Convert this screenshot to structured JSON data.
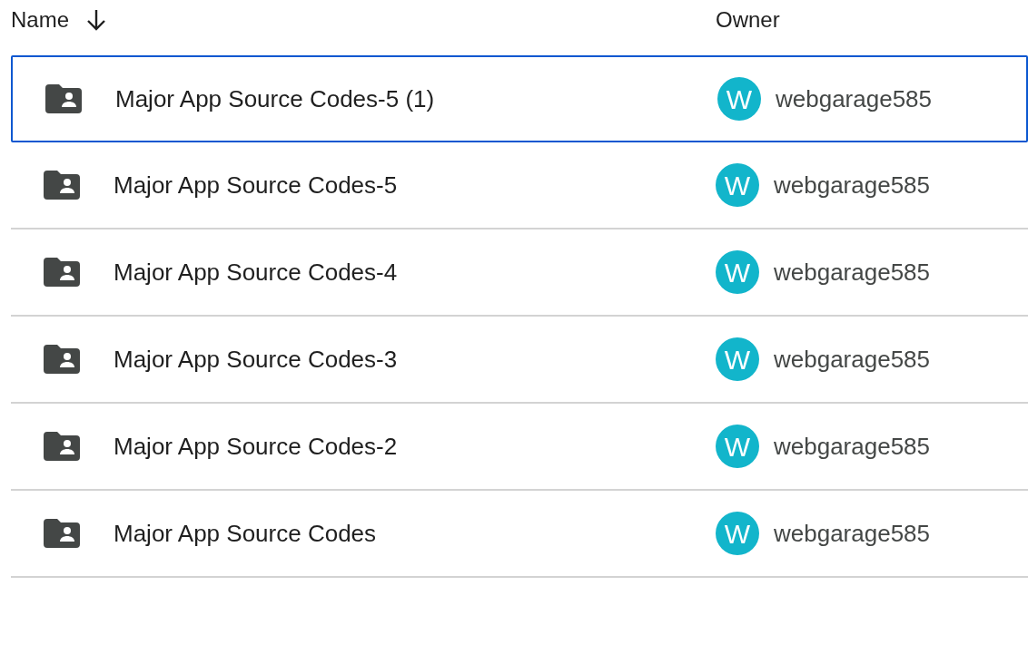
{
  "columns": [
    {
      "label": "Name",
      "sorted": true
    },
    {
      "label": "Owner",
      "sorted": false
    }
  ],
  "rows": [
    {
      "name": "Major App Source Codes-5 (1)",
      "avatar": "W",
      "owner": "webgarage585",
      "selected": true
    },
    {
      "name": "Major App Source Codes-5",
      "avatar": "W",
      "owner": "webgarage585",
      "selected": false
    },
    {
      "name": "Major App Source Codes-4",
      "avatar": "W",
      "owner": "webgarage585",
      "selected": false
    },
    {
      "name": "Major App Source Codes-3",
      "avatar": "W",
      "owner": "webgarage585",
      "selected": false
    },
    {
      "name": "Major App Source Codes-2",
      "avatar": "W",
      "owner": "webgarage585",
      "selected": false
    },
    {
      "name": "Major App Source Codes",
      "avatar": "W",
      "owner": "webgarage585",
      "selected": false
    }
  ]
}
